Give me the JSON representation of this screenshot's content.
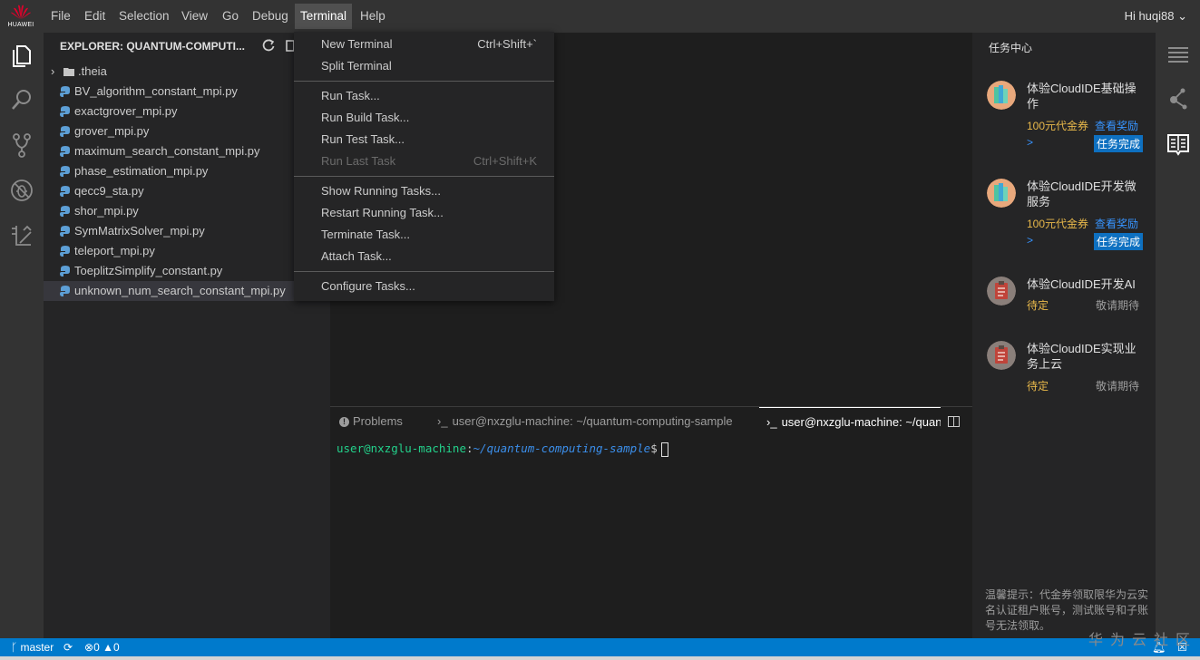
{
  "brand": {
    "name": "HUAWEI",
    "color": "#e4002b"
  },
  "menubar": {
    "items": [
      "File",
      "Edit",
      "Selection",
      "View",
      "Go",
      "Debug",
      "Terminal",
      "Help"
    ],
    "active": "Terminal",
    "user": "Hi huqi88 ⌄"
  },
  "explorer": {
    "title": "EXPLORER: QUANTUM-COMPUTI...",
    "folder": ".theia",
    "files": [
      "BV_algorithm_constant_mpi.py",
      "exactgrover_mpi.py",
      "grover_mpi.py",
      "maximum_search_constant_mpi.py",
      "phase_estimation_mpi.py",
      "qecc9_sta.py",
      "shor_mpi.py",
      "SymMatrixSolver_mpi.py",
      "teleport_mpi.py",
      "ToeplitzSimplify_constant.py",
      "unknown_num_search_constant_mpi.py"
    ],
    "selected_index": 10
  },
  "terminal_menu": {
    "groups": [
      [
        {
          "label": "New Terminal",
          "shortcut": "Ctrl+Shift+`",
          "enabled": true
        },
        {
          "label": "Split Terminal",
          "shortcut": "",
          "enabled": true
        }
      ],
      [
        {
          "label": "Run Task...",
          "shortcut": "",
          "enabled": true
        },
        {
          "label": "Run Build Task...",
          "shortcut": "",
          "enabled": true
        },
        {
          "label": "Run Test Task...",
          "shortcut": "",
          "enabled": true
        },
        {
          "label": "Run Last Task",
          "shortcut": "Ctrl+Shift+K",
          "enabled": false
        }
      ],
      [
        {
          "label": "Show Running Tasks...",
          "shortcut": "",
          "enabled": true
        },
        {
          "label": "Restart Running Task...",
          "shortcut": "",
          "enabled": true
        },
        {
          "label": "Terminate Task...",
          "shortcut": "",
          "enabled": true
        },
        {
          "label": "Attach Task...",
          "shortcut": "",
          "enabled": true
        }
      ],
      [
        {
          "label": "Configure Tasks...",
          "shortcut": "",
          "enabled": true
        }
      ]
    ]
  },
  "panel": {
    "tabs": [
      {
        "label": "Problems",
        "icon": "info-icon"
      },
      {
        "label": "user@nxzglu-machine: ~/quantum-computing-sample",
        "icon": "terminal-icon"
      },
      {
        "label": "user@nxzglu-machine: ~/quan",
        "icon": "terminal-icon"
      }
    ],
    "terminal": {
      "user": "user@nxzglu-machine",
      "sep": ":",
      "path": "~/quantum-computing-sample",
      "prompt": "$"
    }
  },
  "task_center": {
    "title": "任务中心",
    "tasks": [
      {
        "title": "体验CloudIDE基础操作",
        "reward": "100元代金券",
        "link": "查看奖励",
        "arrow": ">",
        "status": "任务完成"
      },
      {
        "title": "体验CloudIDE开发微服务",
        "reward": "100元代金券",
        "link": "查看奖励",
        "arrow": ">",
        "status": "任务完成"
      },
      {
        "title": "体验CloudIDE开发AI",
        "pending": "待定",
        "expect": "敬请期待"
      },
      {
        "title": "体验CloudIDE实现业务上云",
        "pending": "待定",
        "expect": "敬请期待"
      }
    ],
    "tip": "温馨提示：代金券领取限华为云实名认证租户账号，测试账号和子账号无法领取。"
  },
  "statusbar": {
    "branch": "master",
    "errors": "0",
    "warnings": "0"
  },
  "watermark": "华为云社区",
  "colors": {
    "accent": "#007acc",
    "terminal_user": "#23d18b",
    "terminal_path": "#3b8eea",
    "reward": "#e8b84a",
    "link": "#3794ff",
    "done_badge": "#0e70c0"
  }
}
